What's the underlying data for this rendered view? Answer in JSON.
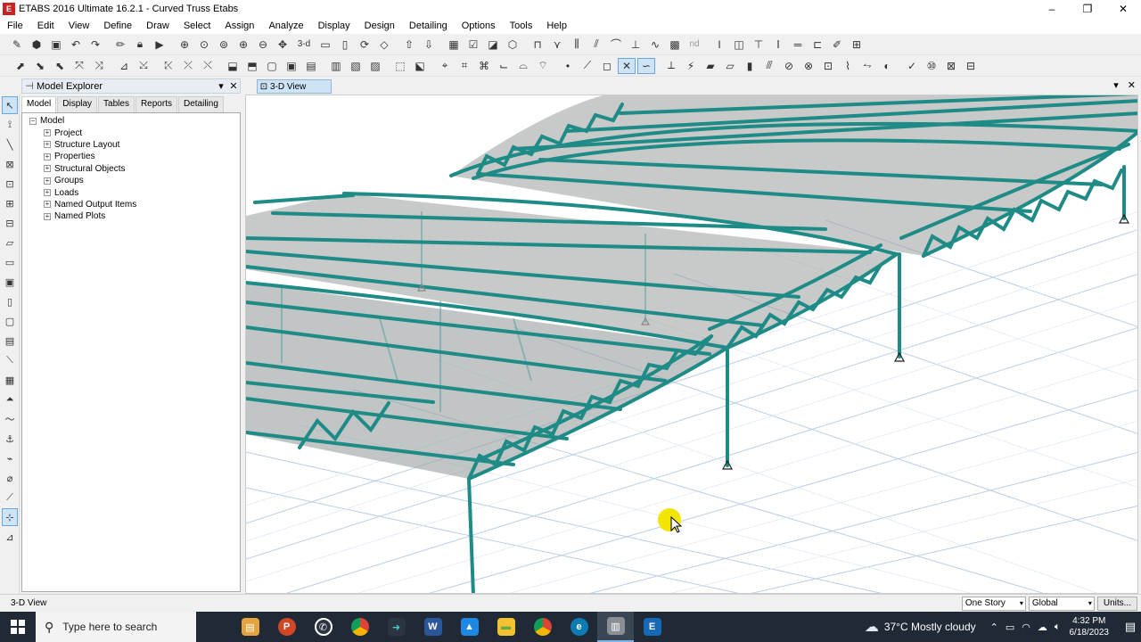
{
  "window": {
    "title": "ETABS 2016 Ultimate 16.2.1 - Curved Truss Etabs",
    "controls": [
      "–",
      "❐",
      "✕"
    ]
  },
  "menu": [
    "File",
    "Edit",
    "View",
    "Define",
    "Draw",
    "Select",
    "Assign",
    "Analyze",
    "Display",
    "Design",
    "Detailing",
    "Options",
    "Tools",
    "Help"
  ],
  "toolbar": {
    "view_3d_label": "3-d",
    "nd_label": "nd"
  },
  "explorer": {
    "title": "Model Explorer",
    "tabs": [
      "Model",
      "Display",
      "Tables",
      "Reports",
      "Detailing"
    ],
    "root": "Model",
    "nodes": [
      "Project",
      "Structure Layout",
      "Properties",
      "Structural Objects",
      "Groups",
      "Loads",
      "Named Output Items",
      "Named Plots"
    ]
  },
  "view": {
    "tab_label": "3-D View",
    "status_label": "3-D View"
  },
  "status": {
    "story": "One Story",
    "coord": "Global",
    "units": "Units..."
  },
  "taskbar": {
    "search_placeholder": "Type here to search",
    "weather": "37°C  Mostly cloudy",
    "time": "4:32 PM",
    "date": "6/18/2023"
  },
  "colors": {
    "member": "#1f8b86",
    "deck": "#9a9e9e",
    "grid": "#b9cfe6",
    "cursor": "#f2e600"
  }
}
